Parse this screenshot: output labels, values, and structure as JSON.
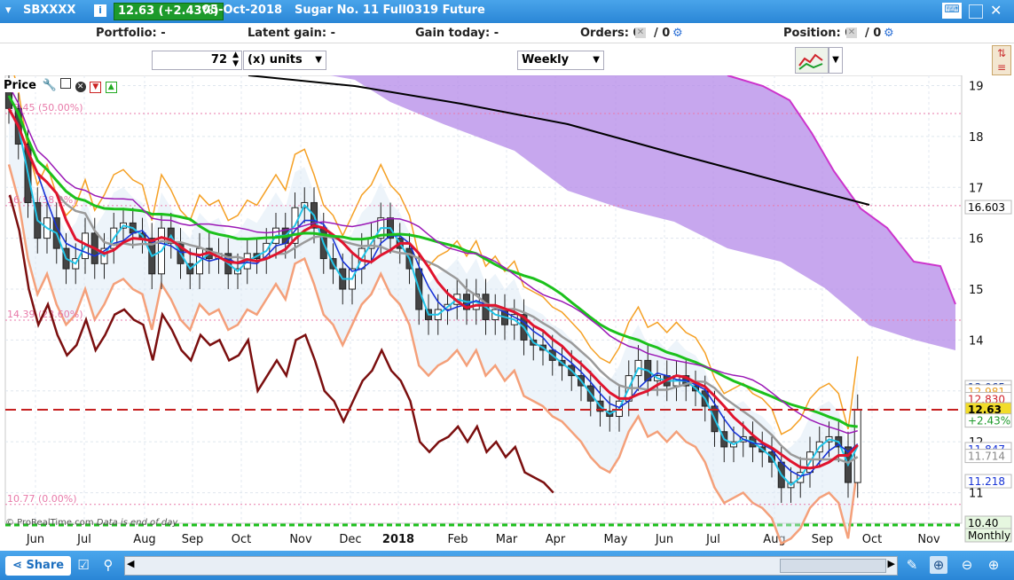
{
  "title_bar": {
    "symbol": "SBXXXX",
    "price": "12.63 (+2.43%)",
    "date": "05-Oct-2018",
    "instrument": "Sugar No. 11 Full0319 Future"
  },
  "info_bar": {
    "portfolio": "Portfolio: -",
    "latent_gain": "Latent gain: -",
    "gain_today": "Gain today: -",
    "orders": "Orders: 0",
    "orders_2": "/ 0",
    "position": "Position: 0",
    "position_2": "/ 0"
  },
  "toolbar": {
    "units_value": "72",
    "units_label": "(x) units",
    "timeframe": "Weekly"
  },
  "panel": {
    "price_label": "Price",
    "copyright": "© ProRealTime.com",
    "data_note": "Data is end of day"
  },
  "bottom": {
    "share_label": "Share"
  },
  "colors": {
    "titlebar": "#2a86d6",
    "price_green": "#1d9a2b",
    "kumo": "#b48ae8",
    "tenkan": "#e0142e",
    "kijun": "#1cc11c",
    "ma_long": "#000000",
    "bollinger": "#f5a024",
    "envelope": "#f4a07a",
    "chikou": "#7b0f0f",
    "last_price_line": "#c62020"
  },
  "icons": [
    "ticker-menu-icon",
    "info-icon",
    "keyboard-icon",
    "orders-settings-icon",
    "position-settings-icon",
    "indicators-icon",
    "tools-icon",
    "properties-icon",
    "duplicate-icon",
    "close-icon",
    "move-down-icon",
    "move-up-icon",
    "share-icon",
    "checklist-icon",
    "pin-icon",
    "draw-icon",
    "zoom-fit-icon",
    "zoom-out-icon",
    "zoom-in-icon"
  ],
  "chart_data": {
    "type": "candlestick",
    "timeframe": "Weekly",
    "yaxis_range": [
      10.4,
      19.2
    ],
    "yticks": [
      "19",
      "18",
      "17",
      "16",
      "15",
      "14",
      "13",
      "12",
      "11"
    ],
    "xticks": [
      "Jun",
      "Jul",
      "Aug",
      "Sep",
      "Oct",
      "Nov",
      "Dec",
      "2018",
      "Feb",
      "Mar",
      "Apr",
      "May",
      "Jun",
      "Jul",
      "Aug",
      "Sep",
      "Oct",
      "Nov"
    ],
    "fibonacci_levels": [
      {
        "label": "18.45 (50.00%)",
        "value": 18.45
      },
      {
        "label": "16.64 (38.2%)",
        "value": 16.64
      },
      {
        "label": "14.39 (23.60%)",
        "value": 14.39
      },
      {
        "label": "10.77 (0.00%)",
        "value": 10.77
      }
    ],
    "price_labels": [
      {
        "label": "13.065",
        "value": 13.065
      },
      {
        "label": "12.981",
        "value": 12.981
      },
      {
        "label": "12.830",
        "value": 12.83
      },
      {
        "label": "12.63",
        "value": 12.63
      },
      {
        "label": "+2.43%",
        "value": 12.41
      },
      {
        "label": "11.847",
        "value": 11.847
      },
      {
        "label": "11.714",
        "value": 11.714
      },
      {
        "label": "11.218",
        "value": 11.218
      },
      {
        "label": "16.603",
        "value": 16.603
      },
      {
        "label": "10.40",
        "value": 10.4
      },
      {
        "label": "Monthly",
        "value": 10.4
      }
    ],
    "last_close": 12.63,
    "change_pct": "+2.43%",
    "closes": [
      18.55,
      17.85,
      16.7,
      16.0,
      16.4,
      15.8,
      15.4,
      15.6,
      16.1,
      15.5,
      15.8,
      16.2,
      16.3,
      16.1,
      16.0,
      15.3,
      16.2,
      15.9,
      15.5,
      15.3,
      15.8,
      15.6,
      15.7,
      15.3,
      15.4,
      15.7,
      15.6,
      15.9,
      16.2,
      15.9,
      16.6,
      16.7,
      16.2,
      15.6,
      15.4,
      15.0,
      15.4,
      15.8,
      16.0,
      16.4,
      16.0,
      15.8,
      15.4,
      14.6,
      14.4,
      14.6,
      14.7,
      14.9,
      14.6,
      14.9,
      14.4,
      14.6,
      14.3,
      14.5,
      14.0,
      13.9,
      13.8,
      13.6,
      13.5,
      13.3,
      13.1,
      12.8,
      12.6,
      12.5,
      12.8,
      13.3,
      13.6,
      13.2,
      13.3,
      13.1,
      13.3,
      13.1,
      13.0,
      12.7,
      12.2,
      11.9,
      12.0,
      12.1,
      11.9,
      11.8,
      11.6,
      11.1,
      11.2,
      11.4,
      11.8,
      12.0,
      12.1,
      11.9,
      11.2,
      12.63
    ]
  }
}
